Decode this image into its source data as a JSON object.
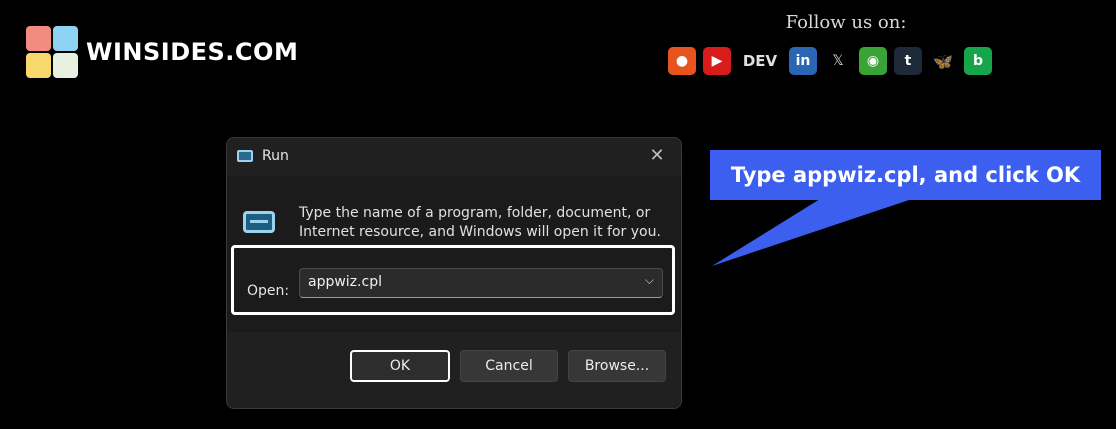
{
  "brand": {
    "name": "WINSIDES.COM",
    "tile_colors": [
      "#f28b82",
      "#8fd3f4",
      "#f9d86b",
      "#e8f0e0"
    ]
  },
  "follow": {
    "label": "Follow us on:",
    "socials": [
      {
        "name": "reddit-icon",
        "bg": "#e8541e",
        "glyph": "●"
      },
      {
        "name": "youtube-icon",
        "bg": "#d81c1c",
        "glyph": "▶"
      },
      {
        "name": "dev-icon",
        "bg": "#000000",
        "glyph": "DEV"
      },
      {
        "name": "linkedin-icon",
        "bg": "#2a66b3",
        "glyph": "in"
      },
      {
        "name": "x-icon",
        "bg": "#000000",
        "glyph": "𝕏"
      },
      {
        "name": "hashnode-icon",
        "bg": "#3aa335",
        "glyph": "◉"
      },
      {
        "name": "tumblr-icon",
        "bg": "#1c2a3a",
        "glyph": "t"
      },
      {
        "name": "bluesky-icon",
        "bg": "#000000",
        "glyph": "🦋"
      },
      {
        "name": "bitchute-icon",
        "bg": "#17a54c",
        "glyph": "b"
      }
    ]
  },
  "dialog": {
    "title": "Run",
    "close_glyph": "✕",
    "description": "Type the name of a program, folder, document, or Internet resource, and Windows will open it for you.",
    "open_label": "Open:",
    "open_value": "appwiz.cpl",
    "chevron": "⌵",
    "buttons": {
      "ok": "OK",
      "cancel": "Cancel",
      "browse": "Browse..."
    }
  },
  "callout": {
    "text": "Type appwiz.cpl, and click OK",
    "color": "#3c5ff0"
  }
}
